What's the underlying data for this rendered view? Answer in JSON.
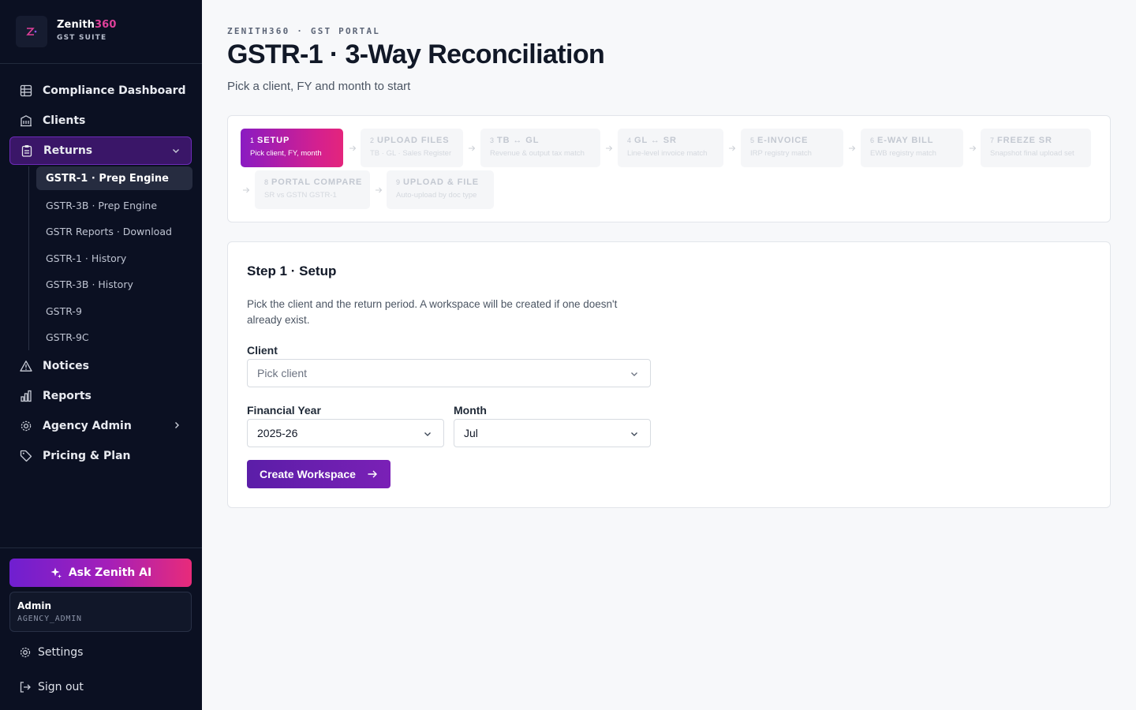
{
  "brand": {
    "name": "Zenith",
    "name_accent": "360",
    "subtitle": "GST SUITE"
  },
  "sidebar": {
    "items": [
      {
        "label": "Compliance Dashboard",
        "icon": "grid-icon"
      },
      {
        "label": "Clients",
        "icon": "building-icon"
      },
      {
        "label": "Returns",
        "icon": "clipboard-icon",
        "expanded": true
      },
      {
        "label": "Notices",
        "icon": "warning-icon"
      },
      {
        "label": "Reports",
        "icon": "bar-chart-icon"
      },
      {
        "label": "Agency Admin",
        "icon": "gear-icon"
      },
      {
        "label": "Pricing & Plan",
        "icon": "tag-icon"
      }
    ],
    "returns_sub": [
      {
        "label": "GSTR-1 · Prep Engine",
        "active": true
      },
      {
        "label": "GSTR-3B · Prep Engine"
      },
      {
        "label": "GSTR Reports · Download"
      },
      {
        "label": "GSTR-1 · History"
      },
      {
        "label": "GSTR-3B · History"
      },
      {
        "label": "GSTR-9"
      },
      {
        "label": "GSTR-9C"
      }
    ],
    "ai_button": "Ask Zenith AI",
    "user": {
      "name": "Admin",
      "role": "AGENCY_ADMIN"
    },
    "settings": "Settings",
    "sign_out": "Sign out"
  },
  "header": {
    "eyebrow": "ZENITH360 · GST PORTAL",
    "title": "GSTR-1 · 3-Way Reconciliation",
    "subtitle": "Pick a client, FY and month to start"
  },
  "steps": [
    {
      "num": "1",
      "title": "SETUP",
      "desc": "Pick client, FY, month",
      "active": true
    },
    {
      "num": "2",
      "title": "UPLOAD FILES",
      "desc": "TB · GL · Sales Register"
    },
    {
      "num": "3",
      "title": "TB ↔ GL",
      "desc": "Revenue & output tax match"
    },
    {
      "num": "4",
      "title": "GL ↔ SR",
      "desc": "Line-level invoice match"
    },
    {
      "num": "5",
      "title": "E-INVOICE",
      "desc": "IRP registry match"
    },
    {
      "num": "6",
      "title": "E-WAY BILL",
      "desc": "EWB registry match"
    },
    {
      "num": "7",
      "title": "FREEZE SR",
      "desc": "Snapshot final upload set"
    },
    {
      "num": "8",
      "title": "PORTAL COMPARE",
      "desc": "SR vs GSTN GSTR-1"
    },
    {
      "num": "9",
      "title": "UPLOAD & FILE",
      "desc": "Auto-upload by doc type"
    }
  ],
  "setup": {
    "title": "Step 1 · Setup",
    "description": "Pick the client and the return period. A workspace will be created if one doesn't already exist.",
    "client_label": "Client",
    "client_placeholder": "Pick client",
    "fy_label": "Financial Year",
    "fy_value": "2025-26",
    "month_label": "Month",
    "month_value": "Jul",
    "submit": "Create Workspace"
  },
  "colors": {
    "sidebar_bg": "#0b1022",
    "accent_purple": "#6f1fd0",
    "accent_pink": "#e82b7a"
  }
}
